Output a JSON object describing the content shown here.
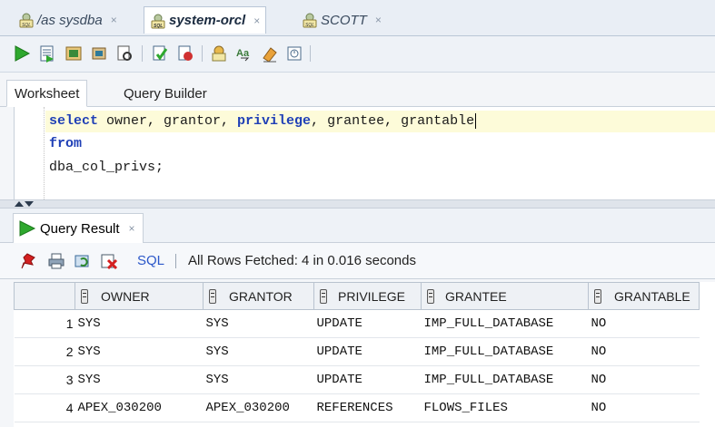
{
  "connection_tabs": [
    {
      "label": "/as sysdba",
      "active": false
    },
    {
      "label": "system-orcl",
      "active": true
    },
    {
      "label": "SCOTT",
      "active": false
    }
  ],
  "close_glyph": "×",
  "toolbar_icons": [
    "run-statement-icon",
    "run-script-icon",
    "autotrace-icon",
    "explain-plan-icon",
    "sql-tuning-icon",
    "commit-icon",
    "rollback-icon",
    "sql-history-icon",
    "format-case-icon",
    "clear-eraser-icon",
    "unshared-worksheet-icon"
  ],
  "worksheet_tabs": [
    {
      "label": "Worksheet",
      "active": true
    },
    {
      "label": "Query Builder",
      "active": false
    }
  ],
  "editor": {
    "line1": {
      "kw1": "select",
      "t1": " owner, grantor, ",
      "kw2": "privilege",
      "t2": ", grantee, grantable"
    },
    "line2": {
      "kw": "from"
    },
    "line3": {
      "text": "dba_col_privs;"
    }
  },
  "result": {
    "tab_label": "Query Result",
    "sql_link": "SQL",
    "status": "All Rows Fetched: 4 in 0.016 seconds",
    "columns": [
      "OWNER",
      "GRANTOR",
      "PRIVILEGE",
      "GRANTEE",
      "GRANTABLE"
    ],
    "rows": [
      {
        "n": "1",
        "owner": "SYS",
        "grantor": "SYS",
        "privilege": "UPDATE",
        "grantee": "IMP_FULL_DATABASE",
        "grantable": "NO"
      },
      {
        "n": "2",
        "owner": "SYS",
        "grantor": "SYS",
        "privilege": "UPDATE",
        "grantee": "IMP_FULL_DATABASE",
        "grantable": "NO"
      },
      {
        "n": "3",
        "owner": "SYS",
        "grantor": "SYS",
        "privilege": "UPDATE",
        "grantee": "IMP_FULL_DATABASE",
        "grantable": "NO"
      },
      {
        "n": "4",
        "owner": "APEX_030200",
        "grantor": "APEX_030200",
        "privilege": "REFERENCES",
        "grantee": "FLOWS_FILES",
        "grantable": "NO"
      }
    ]
  },
  "colors": {
    "keyword": "#1f3fb6",
    "current_line": "#fdfbd9",
    "run_green": "#2ea82e",
    "link_blue": "#2b57c9"
  }
}
